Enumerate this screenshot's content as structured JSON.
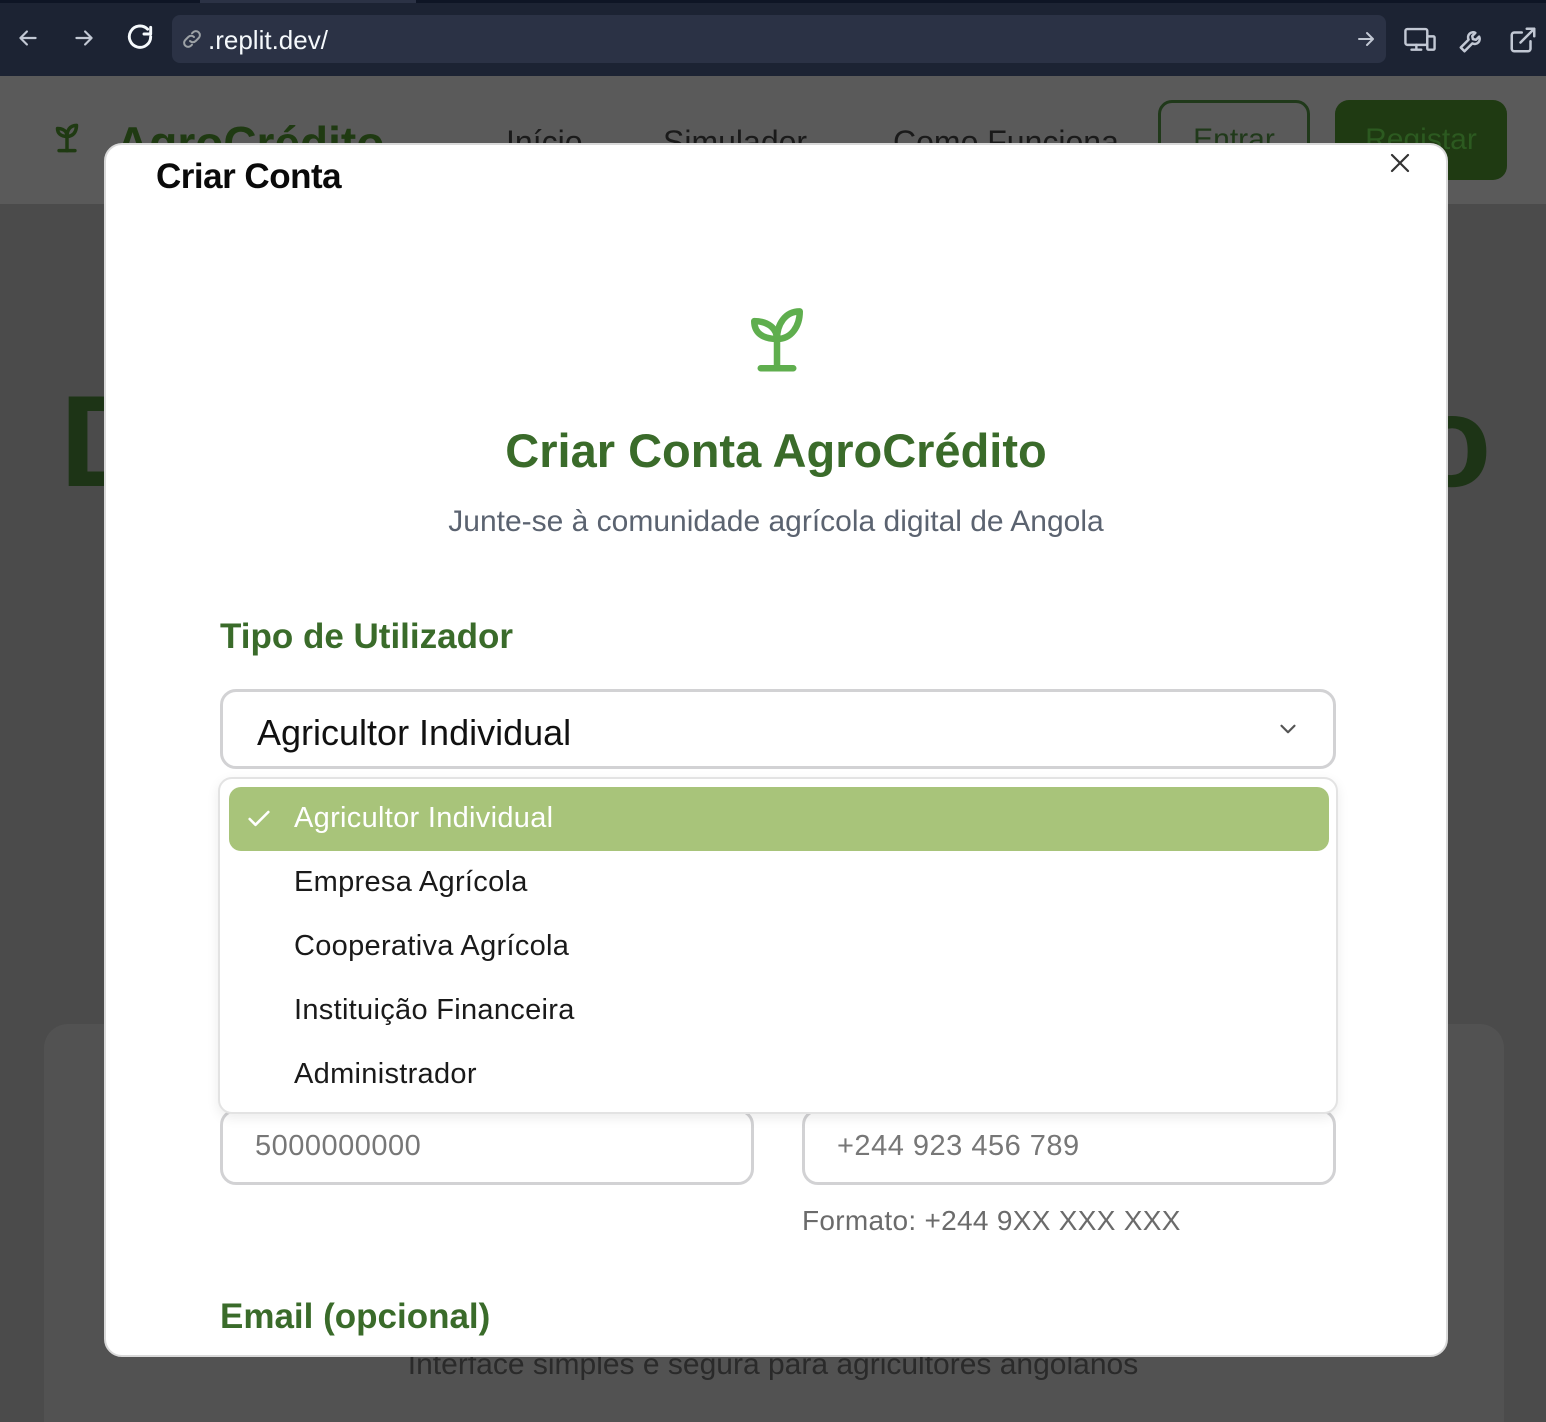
{
  "browser": {
    "url": ".replit.dev/"
  },
  "background": {
    "logo_text": "AgroCrédito",
    "nav": [
      "Início",
      "Simulador",
      "Como Funciona"
    ],
    "entrar": "Entrar",
    "registar": "Registar",
    "hero_left": "D",
    "hero_right": "o",
    "card_text": "Interface simples e segura para agricultores angolanos"
  },
  "modal": {
    "title": "Criar Conta",
    "heading": "Criar Conta AgroCrédito",
    "subheading": "Junte-se à comunidade agrícola digital de Angola",
    "user_type_label": "Tipo de Utilizador",
    "user_type_value": "Agricultor Individual",
    "user_type_options": [
      "Agricultor Individual",
      "Empresa Agrícola",
      "Cooperativa Agrícola",
      "Instituição Financeira",
      "Administrador"
    ],
    "nif_placeholder": "5000000000",
    "phone_placeholder": "+244 923 456 789",
    "phone_hint": "Formato: +244 9XX XXX XXX",
    "email_label": "Email (opcional)"
  },
  "colors": {
    "brand_green": "#3a6b2a",
    "selected_option": "#a8c47a",
    "sprout_icon": "#5fae4e",
    "chrome_bg": "#1c2333"
  }
}
